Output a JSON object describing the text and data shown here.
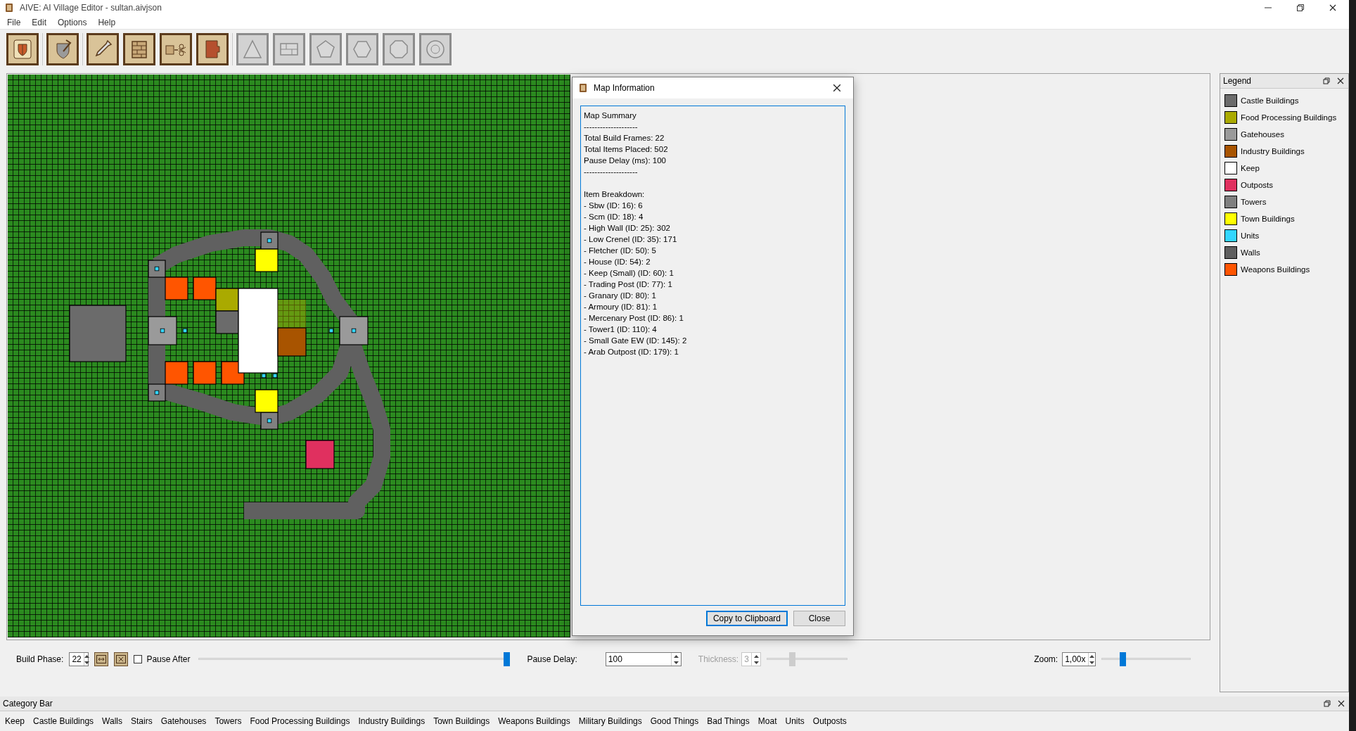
{
  "window": {
    "title": "AIVE: AI Village Editor - sultan.aivjson"
  },
  "menu": [
    "File",
    "Edit",
    "Options",
    "Help"
  ],
  "toolbar_groups": [
    {
      "tools": [
        {
          "disabled": false
        }
      ]
    },
    {
      "tools": [
        {
          "disabled": false
        }
      ]
    },
    {
      "tools": [
        {
          "disabled": false
        },
        {
          "disabled": false
        },
        {
          "disabled": false
        },
        {
          "disabled": false
        }
      ]
    },
    {
      "tools": [
        {
          "disabled": true
        },
        {
          "disabled": true
        },
        {
          "disabled": true
        },
        {
          "disabled": true
        },
        {
          "disabled": true
        },
        {
          "disabled": true
        }
      ]
    }
  ],
  "map_info_dialog": {
    "title": "Map Information",
    "blocks": [
      {
        "lines": [
          "Map Summary",
          "--------------------",
          "Total Build Frames: 22",
          "Total Items Placed: 502",
          "Pause Delay (ms): 100",
          "--------------------"
        ]
      },
      {
        "lines": [
          "Item Breakdown:",
          "- Sbw (ID: 16): 6",
          "- Scm (ID: 18): 4",
          "- High Wall (ID: 25): 302",
          "- Low Crenel (ID: 35): 171",
          "- Fletcher (ID: 50): 5",
          "- House (ID: 54): 2",
          "- Keep (Small) (ID: 60): 1",
          "- Trading Post (ID: 77): 1",
          "- Granary (ID: 80): 1",
          "- Armoury (ID: 81): 1",
          "- Mercenary Post (ID: 86): 1",
          "- Tower1 (ID: 110): 4",
          "- Small Gate EW (ID: 145): 2",
          "- Arab Outpost (ID: 179): 1"
        ]
      }
    ],
    "buttons": [
      {
        "label": "Copy to Clipboard",
        "default": true
      },
      {
        "label": "Close",
        "default": false
      }
    ]
  },
  "legend": {
    "title": "Legend",
    "items": [
      {
        "label": "Castle Buildings",
        "color": "#6b6b6b"
      },
      {
        "label": "Food Processing Buildings",
        "color": "#aaaa00"
      },
      {
        "label": "Gatehouses",
        "color": "#9a9a9a"
      },
      {
        "label": "Industry Buildings",
        "color": "#a85400"
      },
      {
        "label": "Keep",
        "color": "#ffffff"
      },
      {
        "label": "Outposts",
        "color": "#e0305f"
      },
      {
        "label": "Towers",
        "color": "#808080"
      },
      {
        "label": "Town Buildings",
        "color": "#ffff00"
      },
      {
        "label": "Units",
        "color": "#33d6ff"
      },
      {
        "label": "Walls",
        "color": "#5f5f5f"
      },
      {
        "label": "Weapons Buildings",
        "color": "#ff5500"
      }
    ]
  },
  "controls": {
    "build_phase": {
      "label": "Build Phase:",
      "value": "22"
    },
    "pause_after": {
      "label": "Pause After",
      "checked": false
    },
    "phase_slider": {
      "level": 1
    },
    "pause_delay": {
      "label": "Pause Delay:",
      "value": "100"
    },
    "thickness": {
      "label": "Thickness:",
      "value": "3",
      "disabled": true,
      "level": 0.3
    },
    "zoom": {
      "label": "Zoom:",
      "value": "1,00x",
      "level": 0.22
    }
  },
  "category_bar": {
    "title": "Category Bar",
    "items": [
      "Keep",
      "Castle Buildings",
      "Walls",
      "Stairs",
      "Gatehouses",
      "Towers",
      "Food Processing Buildings",
      "Industry Buildings",
      "Town Buildings",
      "Weapons Buildings",
      "Military Buildings",
      "Good Things",
      "Bad Things",
      "Moat",
      "Units",
      "Outposts"
    ]
  }
}
